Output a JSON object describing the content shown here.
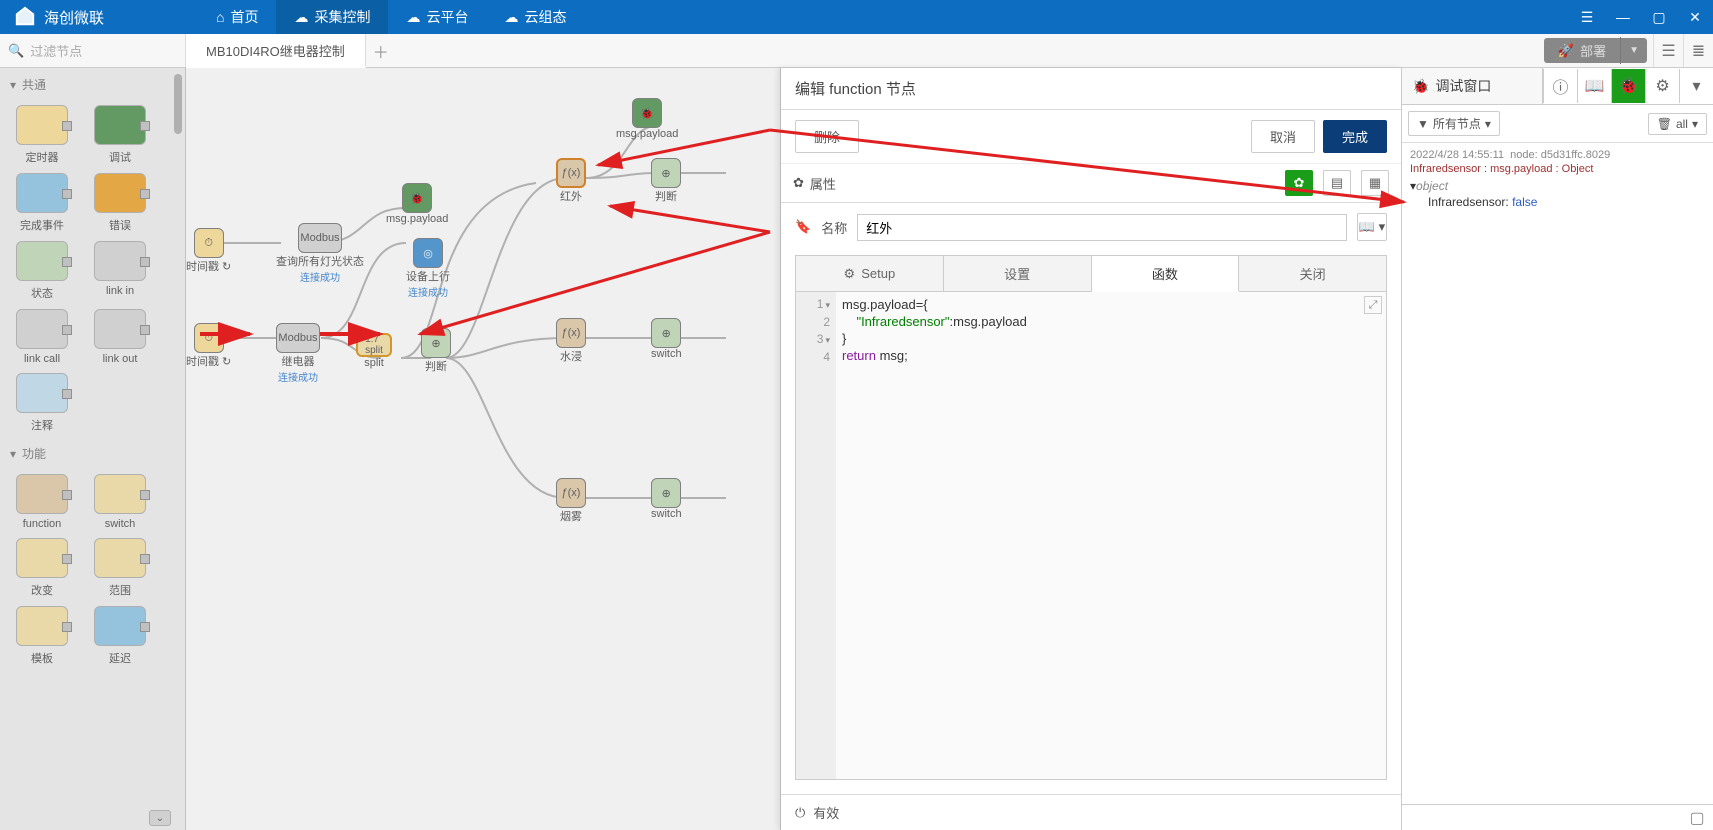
{
  "titlebar": {
    "brand": "海创微联",
    "menus": [
      "首页",
      "采集控制",
      "云平台",
      "云组态"
    ],
    "active_menu_index": 1
  },
  "bar2": {
    "filter_placeholder": "过滤节点",
    "tab": "MB10DI4RO继电器控制",
    "deploy": "部署"
  },
  "palette": {
    "cat_common": "共通",
    "cat_func": "功能",
    "common": [
      [
        "定时器",
        "调试"
      ],
      [
        "完成事件",
        "错误"
      ],
      [
        "状态",
        "link in"
      ],
      [
        "link call",
        "link out"
      ],
      [
        "注释",
        ""
      ]
    ],
    "func": [
      [
        "function",
        "switch"
      ],
      [
        "改变",
        "范围"
      ],
      [
        "模板",
        "延迟"
      ]
    ]
  },
  "canvas_nodes": {
    "t1": "时间戳 ↻",
    "t2": "时间戳 ↻",
    "modbus1": "查询所有灯光状态",
    "modbus1_sub": "连接成功",
    "modbus2": "继电器",
    "modbus2_sub": "连接成功",
    "bug_top": "msg.payload",
    "bug_mid": "msg.payload",
    "dev": "设备上行",
    "dev_sub": "连接成功",
    "split": "split",
    "judge1": "判断",
    "judge2": "判断",
    "fx_ir": "红外",
    "fx_water": "水浸",
    "fx_smoke": "烟雾",
    "sw1": "switch",
    "sw2": "switch"
  },
  "edit": {
    "title": "编辑 function 节点",
    "delete": "删除",
    "cancel": "取消",
    "done": "完成",
    "section": "属性",
    "name_label": "名称",
    "name_value": "红外",
    "tabs": [
      "Setup",
      "设置",
      "函数",
      "关闭"
    ],
    "active_tab_index": 2,
    "code_lines": [
      "msg.payload={",
      "    \"Infraredsensor\":msg.payload",
      "}",
      "return msg;"
    ],
    "enabled": "有效"
  },
  "sidebar": {
    "title": "调试窗口",
    "filter_all_nodes": "所有节点",
    "filter_all": "all",
    "msg_ts": "2022/4/28 14:55:11",
    "msg_node": "node: d5d31ffc.8029",
    "msg_src": "Infraredsensor : msg.payload : Object",
    "obj_label": "object",
    "kv_key": "Infraredsensor:",
    "kv_val": "false"
  }
}
